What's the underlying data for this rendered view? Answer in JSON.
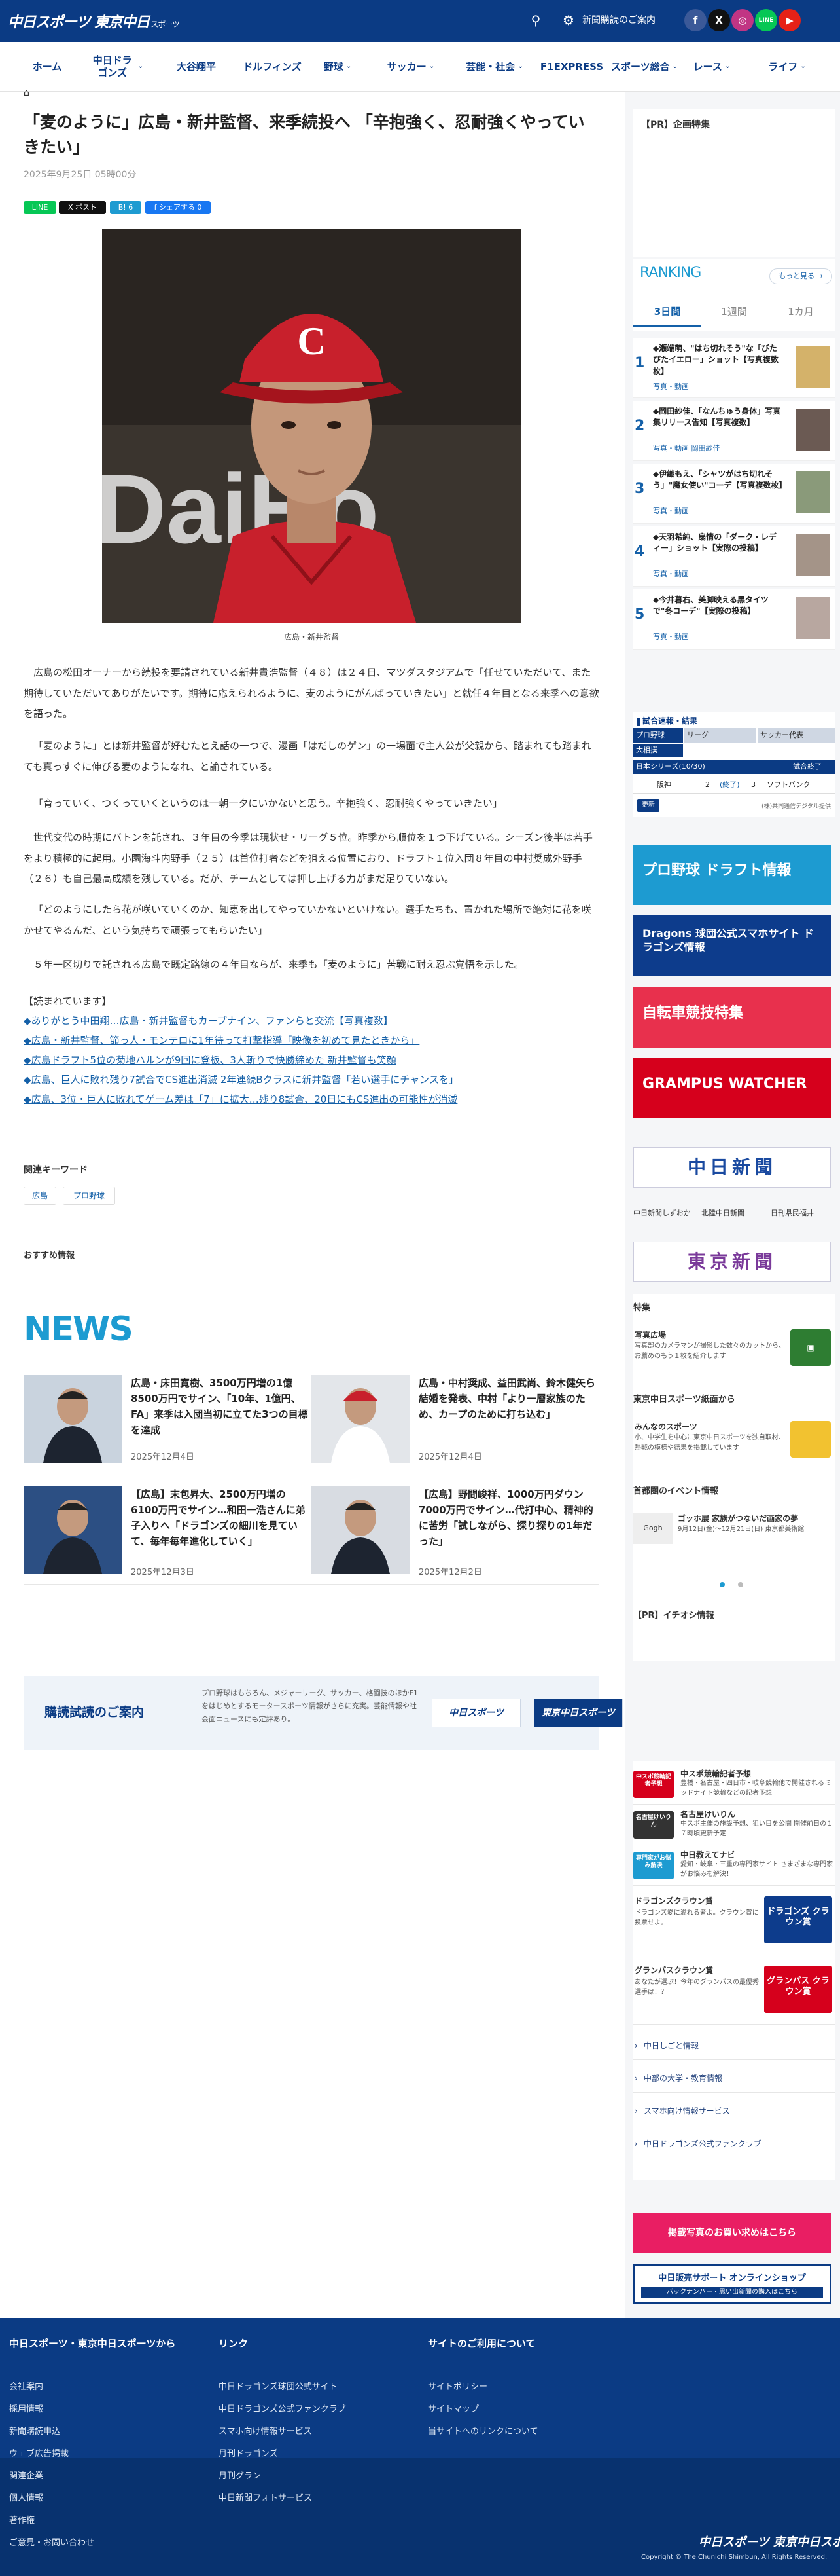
{
  "header": {
    "logo_main": "中日スポーツ 東京中日",
    "logo_sub": "スポーツ",
    "subscribe_link": "新聞購読のご案内",
    "icons": [
      "search-icon",
      "gear-icon"
    ],
    "social": [
      {
        "name": "facebook-icon",
        "glyph": "f",
        "color": "#3b5998"
      },
      {
        "name": "x-icon",
        "glyph": "X",
        "color": "#111111"
      },
      {
        "name": "instagram-icon",
        "glyph": "◎",
        "color": "#c13584"
      },
      {
        "name": "line-icon",
        "glyph": "LINE",
        "color": "#06c755"
      },
      {
        "name": "youtube-icon",
        "glyph": "▶",
        "color": "#e62117"
      }
    ]
  },
  "nav": [
    {
      "label": "ホーム",
      "chevron": false
    },
    {
      "label": "中日ドラゴンズ",
      "chevron": true
    },
    {
      "label": "大谷翔平",
      "chevron": false
    },
    {
      "label": "ドルフィンズ",
      "chevron": false
    },
    {
      "label": "野球",
      "chevron": true
    },
    {
      "label": "サッカー",
      "chevron": true
    },
    {
      "label": "芸能・社会",
      "chevron": true
    },
    {
      "label": "F1EXPRESS",
      "chevron": false
    },
    {
      "label": "スポーツ総合",
      "chevron": true
    },
    {
      "label": "レース",
      "chevron": true
    },
    {
      "label": "ライフ",
      "chevron": true
    }
  ],
  "article": {
    "title": "「麦のように」広島・新井監督、来季続投へ 「辛抱強く、忍耐強くやっていきたい」",
    "date": "2025年9月25日 05時00分",
    "share": [
      {
        "label": "LINE",
        "color": "#06c755"
      },
      {
        "label": "X ポスト",
        "color": "#111111"
      },
      {
        "label": "B! 6",
        "color": "#1e9bd1"
      },
      {
        "label": "f シェアする 0",
        "color": "#1877f2"
      }
    ],
    "photo_caption": "広島・新井監督",
    "photo_bg_text": "DaiHo",
    "paragraphs": [
      "広島の松田オーナーから続投を要請されている新井貴浩監督（４８）は２４日、マツダスタジアムで「任せていただいて、また期待していただいてありがたいです。期待に応えられるように、麦のようにがんばっていきたい」と就任４年目となる来季への意欲を語った。",
      "「麦のように」とは新井監督が好むたとえ話の一つで、漫画「はだしのゲン」の一場面で主人公が父親から、踏まれても踏まれても真っすぐに伸びる麦のようになれ、と諭されている。",
      "「育っていく、つくっていくというのは一朝一夕にいかないと思う。辛抱強く、忍耐強くやっていきたい」",
      "世代交代の時期にバトンを託され、３年目の今季は現状せ・リーグ５位。昨季から順位を１つ下げている。シーズン後半は若手をより積極的に起用。小園海斗内野手（２５）は首位打者などを狙える位置におり、ドラフト１位入団８年目の中村奨成外野手（２６）も自己最高成績を残している。だが、チームとしては押し上げる力がまだ足りていない。",
      "「どのようにしたら花が咲いていくのか、知恵を出してやっていかないといけない。選手たちも、置かれた場所で絶対に花を咲かせてやるんだ、という気持ちで頑張ってもらいたい」",
      "５年一区切りで託される広島で既定路線の４年目ならが、来季も「麦のように」苦戦に耐え忍ぶ覚悟を示した。"
    ],
    "related_heading": "【読まれています】",
    "related_links": [
      "◆ありがとう中田翔…広島・新井監督もカープナイン、ファンらと交流【写真複数】",
      "◆広島・新井監督、節っ人・モンテロに1年待って打撃指導「映像を初めて見たときから」",
      "◆広島ドラフト5位の菊地ハルンが9回に登板、3人斬りで快勝締めた 新井監督も笑顔",
      "◆広島、巨人に敗れ残り7試合でCS進出消滅 2年連続Bクラスに新井監督「若い選手にチャンスを」",
      "◆広島、3位・巨人に敗れてゲーム差は「7」に拡大…残り8試合、20日にもCS進出の可能性が消滅"
    ],
    "keywords_heading": "関連キーワード",
    "keywords": [
      "広島",
      "プロ野球"
    ],
    "recommend_heading": "おすすめ情報"
  },
  "news": {
    "heading": "NEWS",
    "items": [
      {
        "title": "広島・床田寛樹、3500万円増の1億8500万円でサイン、「10年、1億円、FA」来季は入団当初に立てた3つの目標を達成",
        "date": "2025年12月4日"
      },
      {
        "title": "広島・中村奨成、益田武尚、鈴木健矢ら結婚を発表、中村「より一層家族のため、カープのために打ち込む」",
        "date": "2025年12月4日"
      },
      {
        "title": "【広島】末包昇大、2500万円増の6100万円でサイン…和田一浩さんに弟子入りへ「ドラゴンズの細川を見ていて、毎年毎年進化していく」",
        "date": "2025年12月3日"
      },
      {
        "title": "【広島】野間峻祥、1000万円ダウン7000万円でサイン…代打中心、精神的に苦労「試しながら、探り探りの1年だった」",
        "date": "2025年12月2日"
      }
    ]
  },
  "subscription": {
    "title": "購読試読のご案内",
    "text": "プロ野球はもちろん、メジャーリーグ、サッカー、格闘技のほかF1をはじめとするモータースポーツ情報がさらに充実。芸能情報や社会面ニュースにも定評あり。",
    "logo1": "中日スポーツ",
    "logo2": "東京中日スポーツ"
  },
  "sidebar": {
    "pr_heading": "【PR】企画特集",
    "ranking_heading": "RANKING",
    "ranking_more": "もっと見る →",
    "tabs": [
      "3日間",
      "1週間",
      "1カ月"
    ],
    "ranking": [
      {
        "num": "1",
        "title": "◆瀬端萌、\"はち切れそう\"な「びたびたイエロー」ショット【写真複数枚】",
        "cat": "写真・動画"
      },
      {
        "num": "2",
        "title": "◆岡田紗佳、「なんちゅう身体」写真集リリース告知【写真複数】",
        "cat": "写真・動画 岡田紗佳"
      },
      {
        "num": "3",
        "title": "◆伊織もえ、「シャツがはち切れそう」\"魔女使い\"コーデ【写真複数枚】",
        "cat": "写真・動画"
      },
      {
        "num": "4",
        "title": "◆天羽希純、扇情の「ダーク・レディー」ショット【実際の投稿】",
        "cat": "写真・動画"
      },
      {
        "num": "5",
        "title": "◆今井暮右、美脚映える黒タイツで\"冬コーデ\"【実際の投稿】",
        "cat": "写真・動画"
      }
    ],
    "score": {
      "heading": "試合速報・結果",
      "tabs": [
        "プロ野球",
        "リーグ",
        "サッカー代表"
      ],
      "subtab": "大相撲",
      "league": "日本シリーズ(10/30)",
      "status": "試合終了",
      "home": "阪神",
      "home_score": "2",
      "mid": "(終了)",
      "away_score": "3",
      "away": "ソフトバンク",
      "update_label": "更新",
      "note": "(株)共同通信デジタル提供"
    },
    "banners": [
      {
        "name": "draft-banner",
        "text": "プロ野球 ドラフト情報",
        "color": "#1d9bd1"
      },
      {
        "name": "dragons-banner",
        "text": "Dragons 球団公式スマホサイト ドラゴンズ情報",
        "color": "#0d3c8c"
      },
      {
        "name": "bicycle-race-banner",
        "text": "自転車競技特集",
        "color": "#e8304d"
      },
      {
        "name": "grampus-banner",
        "text": "GRAMPUS WATCHER",
        "color": "#d6001c"
      }
    ],
    "chunichi_newspaper": "中日新聞",
    "chunichi_links": [
      "中日新聞しずおか",
      "北陸中日新聞",
      "日刊県民福井"
    ],
    "tokyo_newspaper": "東京新聞",
    "special_heading": "特集",
    "special_title": "写真広場",
    "special_desc": "写真部のカメラマンが撮影した数々のカットから、お薦めのもう１枚を紹介します",
    "paper_heading": "東京中日スポーツ紙面から",
    "paper_title": "みんなのスポーツ",
    "paper_desc": "小、中学生を中心に東京中日スポーツを独自取材、熱戦の模様や結果を掲載しています",
    "event_heading": "首都圏のイベント情報",
    "event_title": "ゴッホ展 家族がつないだ画家の夢",
    "event_desc": "9月12日(金)〜12月21日(日) 東京都美術館",
    "pr2_heading": "【PR】イチオシ情報",
    "pr_rows": [
      {
        "title": "中スポ競輪記者予想",
        "desc": "豊橋・名古屋・四日市・岐阜競輪他で開催されるミッドナイト競輪などの記者予想",
        "color": "#d6001c",
        "icon": "中スポ競輪記者予想"
      },
      {
        "title": "名古屋けいりん",
        "desc": "中スポ主催の施設予想、狙い目を公開 開催前日の１７時頃更新予定",
        "color": "#333333",
        "icon": "名古屋けいりん"
      },
      {
        "title": "中日教えてナビ",
        "desc": "愛知・岐阜・三重の専門家サイト さまざまな専門家がお悩みを解決！",
        "color": "#1d9bd1",
        "icon": "専門家がお悩み解決"
      }
    ],
    "crown_rows": [
      {
        "title": "ドラゴンズクラウン賞",
        "desc": "ドラゴンズ愛に溢れる者よ。クラウン賞に投票せよ。",
        "color": "#0d3c8c",
        "icon": "ドラゴンズ クラウン賞"
      },
      {
        "title": "グランパスクラウン賞",
        "desc": "あなたが選ぶ！今年のグランパスの最優秀選手は！？",
        "color": "#d6001c",
        "icon": "グランパス クラウン賞"
      }
    ],
    "links": [
      "中日しごと情報",
      "中部の大学・教育情報",
      "スマホ向け情報サービス",
      "中日ドラゴンズ公式ファンクラブ"
    ],
    "photo_service": "掲載写真のお買い求めはこちら",
    "online_shop": "中日販売サポート オンラインショップ",
    "online_shop_sub": "バックナンバー・思い出新聞の購入はこちら"
  },
  "footer": {
    "col1_heading": "中日スポーツ・東京中日スポーツから",
    "col2_heading": "リンク",
    "col3_heading": "サイトのご利用について",
    "col1": [
      "会社案内",
      "採用情報",
      "新聞購読申込",
      "ウェブ広告掲載"
    ],
    "col1_lower": [
      "関連企業",
      "個人情報",
      "著作権",
      "ご意見・お問い合わせ"
    ],
    "col2": [
      "中日ドラゴンズ球団公式サイト",
      "中日ドラゴンズ公式ファンクラブ",
      "スマホ向け情報サービス",
      "月刊ドラゴンズ"
    ],
    "col2_lower": [
      "月刊グラン",
      "中日新聞フォトサービス"
    ],
    "col3": [
      "サイトポリシー",
      "サイトマップ",
      "当サイトへのリンクについて"
    ],
    "logo": "中日スポーツ 東京中日スポーツ",
    "copyright": "Copyright © The Chunichi Shimbun, All Rights Reserved."
  }
}
